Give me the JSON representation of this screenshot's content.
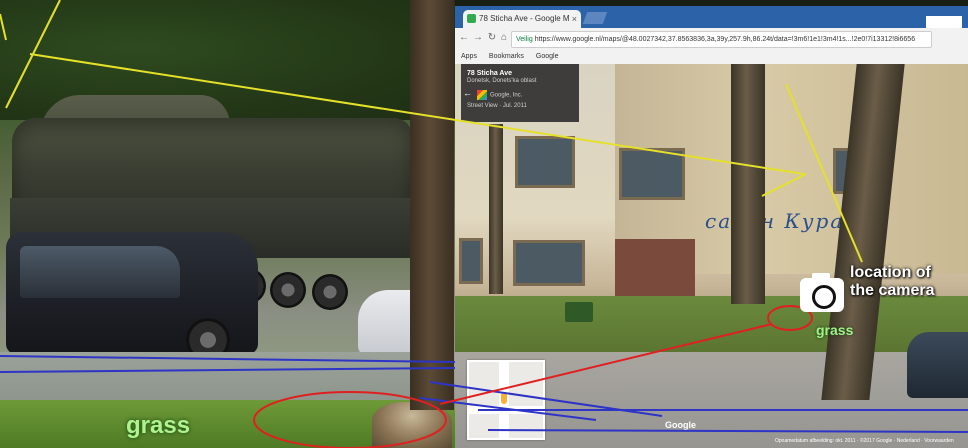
{
  "browser": {
    "tab_title": "78 Sticha Ave - Google M",
    "tab_close": "×",
    "nav": {
      "back": "←",
      "forward": "→",
      "reload": "↻",
      "home": "⌂"
    },
    "secure_label": "Veilig",
    "url": "https://www.google.nl/maps/@48.0027342,37.8563836,3a,39y,257.9h,86.24t/data=!3m6!1e1!3m4!1s...!2e0!7i13312!8i6656",
    "bookmarks": [
      "Apps",
      "Bookmarks",
      "Google"
    ]
  },
  "streetview": {
    "address": "78 Sticha Ave",
    "region": "Donetsk, Donets'ka oblast",
    "photo_credit": "Google, Inc.",
    "capture_date": "Street View · Jul. 2011",
    "sign_text": "салон Кураж",
    "watermark": "Google",
    "footer": "Opnamedatum afbeelding: okt. 2011 · ©2017 Google · Nederland · Voorwaarden"
  },
  "annotations": {
    "camera_label_line1": "location of",
    "camera_label_line2": "the camera",
    "grass_right": "grass",
    "grass_left": "grass"
  },
  "colors": {
    "yellow_lines": "#e5e02a",
    "blue_lines": "#2e34c6",
    "red_lines": "#e02020"
  }
}
